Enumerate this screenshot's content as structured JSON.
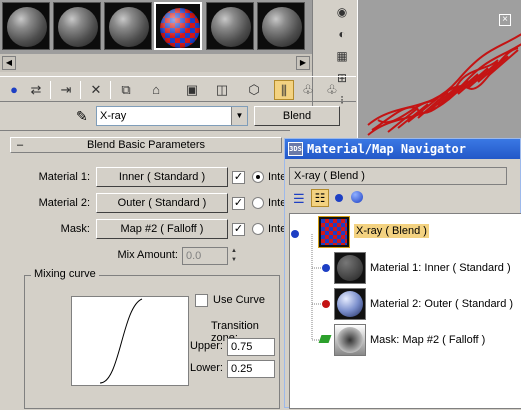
{
  "toolbar": {
    "material_name": "X-ray",
    "type_button": "Blend"
  },
  "rollout": {
    "title": "Blend Basic Parameters",
    "material1_label": "Material 1:",
    "material1_value": "Inner  ( Standard )",
    "material2_label": "Material 2:",
    "material2_value": "Outer  ( Standard )",
    "mask_label": "Mask:",
    "mask_value": "Map #2  ( Falloff )",
    "interactive_label": "Inte",
    "mix_amount_label": "Mix Amount:",
    "mix_amount_value": "0.0",
    "mixing_curve_title": "Mixing curve",
    "use_curve_label": "Use Curve",
    "transition_zone_label": "Transition zone:",
    "upper_label": "Upper:",
    "upper_value": "0.75",
    "lower_label": "Lower:",
    "lower_value": "0.25"
  },
  "navigator": {
    "title": "Material/Map Navigator",
    "current": "X-ray ( Blend )",
    "tree": [
      {
        "label": "X-ray  ( Blend )",
        "selected": true
      },
      {
        "label": "Material 1: Inner  ( Standard )"
      },
      {
        "label": "Material 2: Outer  ( Standard )"
      },
      {
        "label": "Mask: Map #2  ( Falloff )"
      }
    ]
  },
  "colors": {
    "window_title_bar": "#2358c8",
    "selection_highlight": "#f3d281",
    "checker_red": "#d21818",
    "checker_blue": "#1d3fc4"
  }
}
